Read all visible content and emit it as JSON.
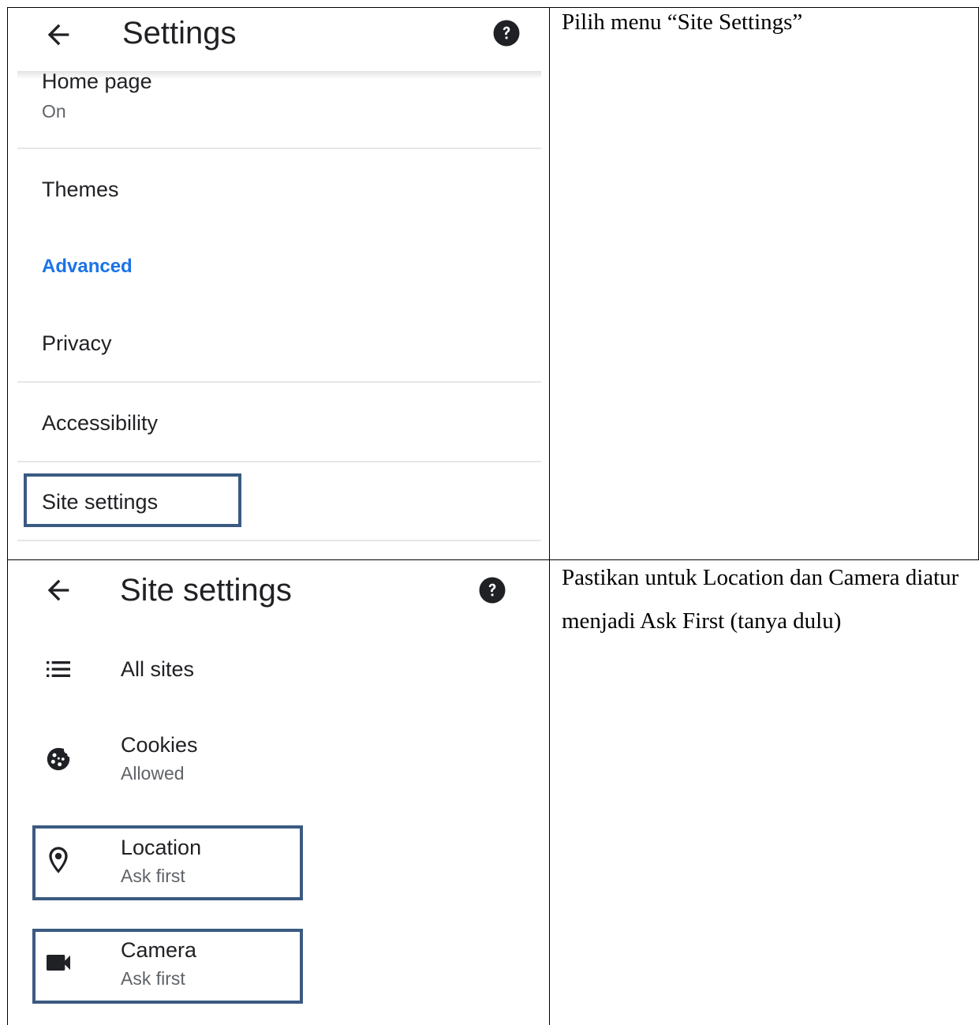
{
  "row1": {
    "screen": {
      "title": "Settings",
      "items": [
        {
          "title": "Home page",
          "subtitle": "On"
        },
        {
          "title": "Themes"
        },
        {
          "section": "Advanced"
        },
        {
          "title": "Privacy"
        },
        {
          "title": "Accessibility"
        },
        {
          "title": "Site settings",
          "highlighted": true
        }
      ]
    },
    "instruction": "Pilih menu “Site Settings”"
  },
  "row2": {
    "screen": {
      "title": "Site settings",
      "items": [
        {
          "icon": "list-icon",
          "title": "All sites"
        },
        {
          "icon": "cookie-icon",
          "title": "Cookies",
          "subtitle": "Allowed"
        },
        {
          "icon": "location-pin-icon",
          "title": "Location",
          "subtitle": "Ask first",
          "highlighted": true
        },
        {
          "icon": "videocam-icon",
          "title": "Camera",
          "subtitle": "Ask first",
          "highlighted": true
        }
      ]
    },
    "instruction": "Pastikan untuk Location dan Camera diatur menjadi Ask First (tanya dulu)"
  },
  "colors": {
    "accent_blue": "#1a73e8",
    "highlight_border": "#3b5a82",
    "primary_text": "#202124",
    "secondary_text": "#5f6368",
    "divider": "#e6e6e6"
  }
}
